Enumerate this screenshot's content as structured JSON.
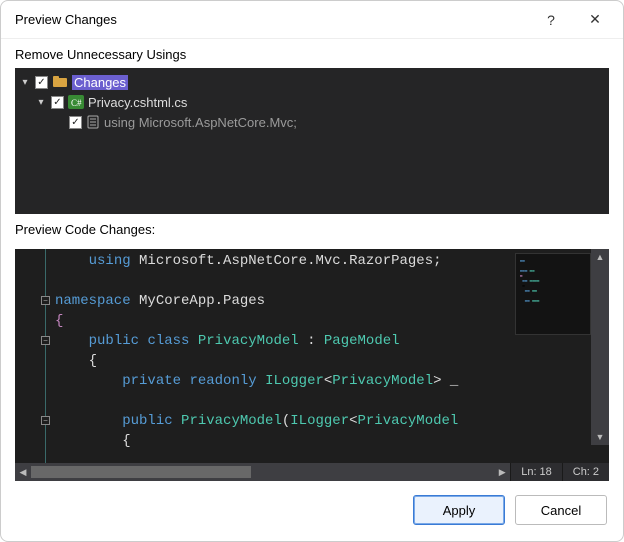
{
  "title": "Preview Changes",
  "help_glyph": "?",
  "close_glyph": "✕",
  "sections": {
    "tree_label": "Remove Unnecessary Usings",
    "code_label": "Preview Code Changes:"
  },
  "tree": {
    "root": {
      "label": "Changes",
      "checked": true
    },
    "file": {
      "label": "Privacy.cshtml.cs",
      "checked": true
    },
    "using": {
      "label": "using Microsoft.AspNetCore.Mvc;",
      "checked": true
    }
  },
  "code": {
    "lines": [
      {
        "indent": 1,
        "tokens": [
          [
            "kw",
            "using"
          ],
          [
            "punct",
            " Microsoft"
          ],
          [
            "punct",
            "."
          ],
          [
            "punct",
            "AspNetCore"
          ],
          [
            "punct",
            "."
          ],
          [
            "punct",
            "Mvc"
          ],
          [
            "punct",
            "."
          ],
          [
            "punct",
            "RazorPages"
          ],
          [
            "punct",
            ";"
          ]
        ]
      },
      {
        "indent": 0,
        "tokens": []
      },
      {
        "indent": 0,
        "fold": true,
        "tokens": [
          [
            "kw",
            "namespace"
          ],
          [
            "punct",
            " MyCoreApp"
          ],
          [
            "punct",
            "."
          ],
          [
            "punct",
            "Pages"
          ]
        ]
      },
      {
        "indent": 0,
        "tokens": [
          [
            "brace",
            "{"
          ]
        ]
      },
      {
        "indent": 1,
        "fold": true,
        "tokens": [
          [
            "kw",
            "public"
          ],
          [
            "punct",
            " "
          ],
          [
            "kw",
            "class"
          ],
          [
            "punct",
            " "
          ],
          [
            "type",
            "PrivacyModel"
          ],
          [
            "punct",
            " : "
          ],
          [
            "type",
            "PageModel"
          ]
        ]
      },
      {
        "indent": 1,
        "tokens": [
          [
            "punct",
            "{"
          ]
        ]
      },
      {
        "indent": 2,
        "tokens": [
          [
            "kw",
            "private"
          ],
          [
            "punct",
            " "
          ],
          [
            "kw",
            "readonly"
          ],
          [
            "punct",
            " "
          ],
          [
            "type",
            "ILogger"
          ],
          [
            "punct",
            "<"
          ],
          [
            "type",
            "PrivacyModel"
          ],
          [
            "punct",
            "> _"
          ]
        ]
      },
      {
        "indent": 0,
        "tokens": []
      },
      {
        "indent": 2,
        "fold": true,
        "tokens": [
          [
            "kw",
            "public"
          ],
          [
            "punct",
            " "
          ],
          [
            "type",
            "PrivacyModel"
          ],
          [
            "punct",
            "("
          ],
          [
            "type",
            "ILogger"
          ],
          [
            "punct",
            "<"
          ],
          [
            "type",
            "PrivacyModel"
          ]
        ]
      },
      {
        "indent": 2,
        "tokens": [
          [
            "punct",
            "{"
          ]
        ]
      }
    ]
  },
  "status": {
    "line_label": "Ln:",
    "line": "18",
    "col_label": "Ch:",
    "col": "2"
  },
  "buttons": {
    "apply": "Apply",
    "cancel": "Cancel"
  }
}
